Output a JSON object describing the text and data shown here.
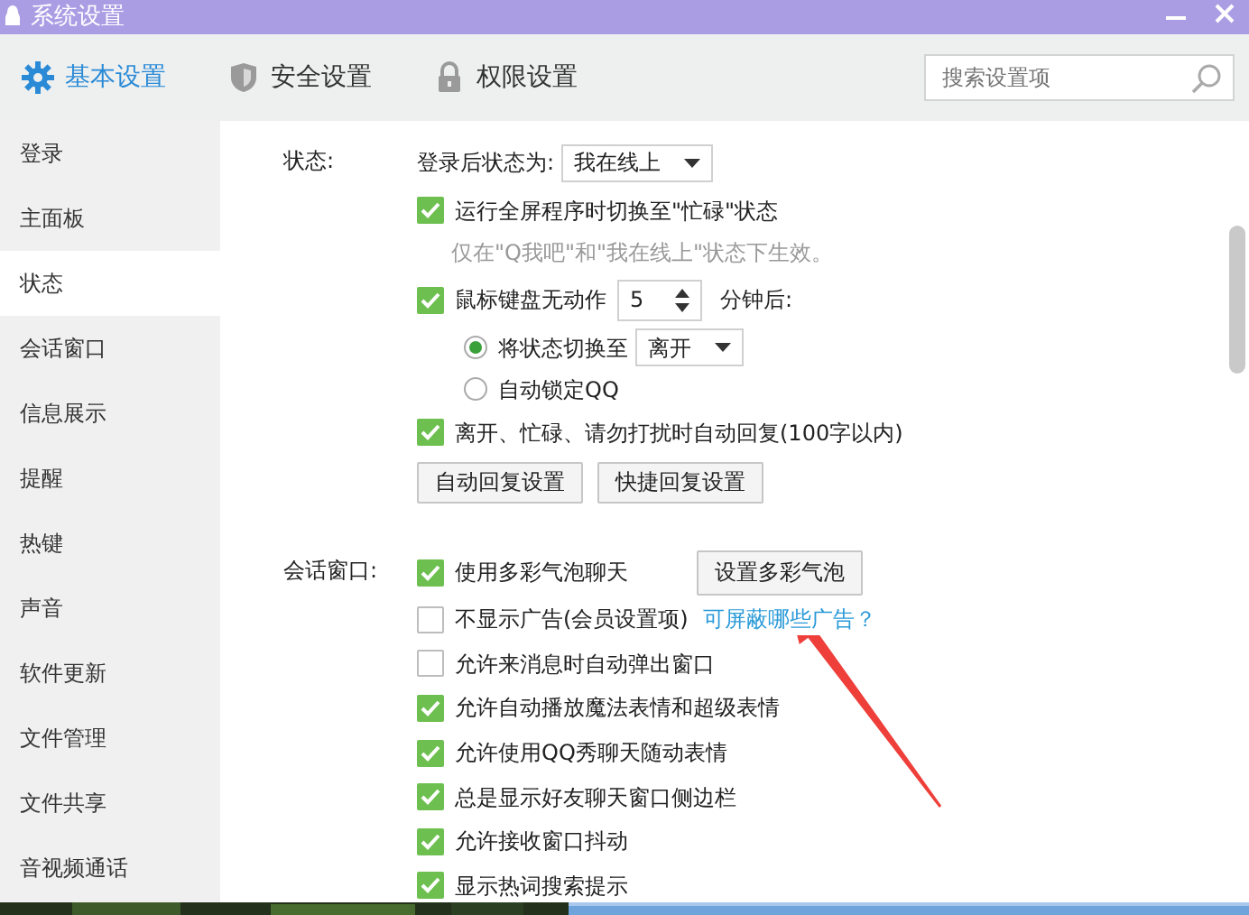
{
  "window": {
    "title": "系统设置"
  },
  "tabs": [
    {
      "label": "基本设置",
      "selected": true
    },
    {
      "label": "安全设置",
      "selected": false
    },
    {
      "label": "权限设置",
      "selected": false
    }
  ],
  "search": {
    "placeholder": "搜索设置项"
  },
  "sidebar": {
    "items": [
      {
        "label": "登录",
        "selected": false
      },
      {
        "label": "主面板",
        "selected": false
      },
      {
        "label": "状态",
        "selected": true
      },
      {
        "label": "会话窗口",
        "selected": false
      },
      {
        "label": "信息展示",
        "selected": false
      },
      {
        "label": "提醒",
        "selected": false
      },
      {
        "label": "热键",
        "selected": false
      },
      {
        "label": "声音",
        "selected": false
      },
      {
        "label": "软件更新",
        "selected": false
      },
      {
        "label": "文件管理",
        "selected": false
      },
      {
        "label": "文件共享",
        "selected": false
      },
      {
        "label": "音视频通话",
        "selected": false
      }
    ]
  },
  "sections": [
    {
      "label": "状态:",
      "items": [
        {
          "kind": "select",
          "label": "登录后状态为:",
          "value": "我在线上"
        },
        {
          "kind": "checkbox",
          "label": "运行全屏程序时切换至\"忙碌\"状态",
          "checked": true
        },
        {
          "kind": "note",
          "text": "仅在\"Q我吧\"和\"我在线上\"状态下生效。"
        },
        {
          "kind": "spinner",
          "label": "鼠标键盘无动作",
          "checked": true,
          "value": "5",
          "suffix": "分钟后:"
        },
        {
          "kind": "radio-select",
          "label": "将状态切换至",
          "selected": true,
          "value": "离开"
        },
        {
          "kind": "radio",
          "label": "自动锁定QQ",
          "selected": false
        },
        {
          "kind": "checkbox",
          "label": "离开、忙碌、请勿打扰时自动回复(100字以内)",
          "checked": true
        },
        {
          "kind": "buttons",
          "buttons": [
            "自动回复设置",
            "快捷回复设置"
          ]
        }
      ]
    },
    {
      "label": "会话窗口:",
      "items": [
        {
          "kind": "checkbox-button",
          "label": "使用多彩气泡聊天",
          "checked": true,
          "button": "设置多彩气泡"
        },
        {
          "kind": "checkbox-link",
          "label": "不显示广告(会员设置项)",
          "checked": false,
          "link": "可屏蔽哪些广告？"
        },
        {
          "kind": "checkbox",
          "label": "允许来消息时自动弹出窗口",
          "checked": false
        },
        {
          "kind": "checkbox",
          "label": "允许自动播放魔法表情和超级表情",
          "checked": true
        },
        {
          "kind": "checkbox",
          "label": "允许使用QQ秀聊天随动表情",
          "checked": true
        },
        {
          "kind": "checkbox",
          "label": "总是显示好友聊天窗口侧边栏",
          "checked": true
        },
        {
          "kind": "checkbox",
          "label": "允许接收窗口抖动",
          "checked": true
        },
        {
          "kind": "checkbox",
          "label": "显示热词搜索提示",
          "checked": true
        }
      ]
    }
  ]
}
